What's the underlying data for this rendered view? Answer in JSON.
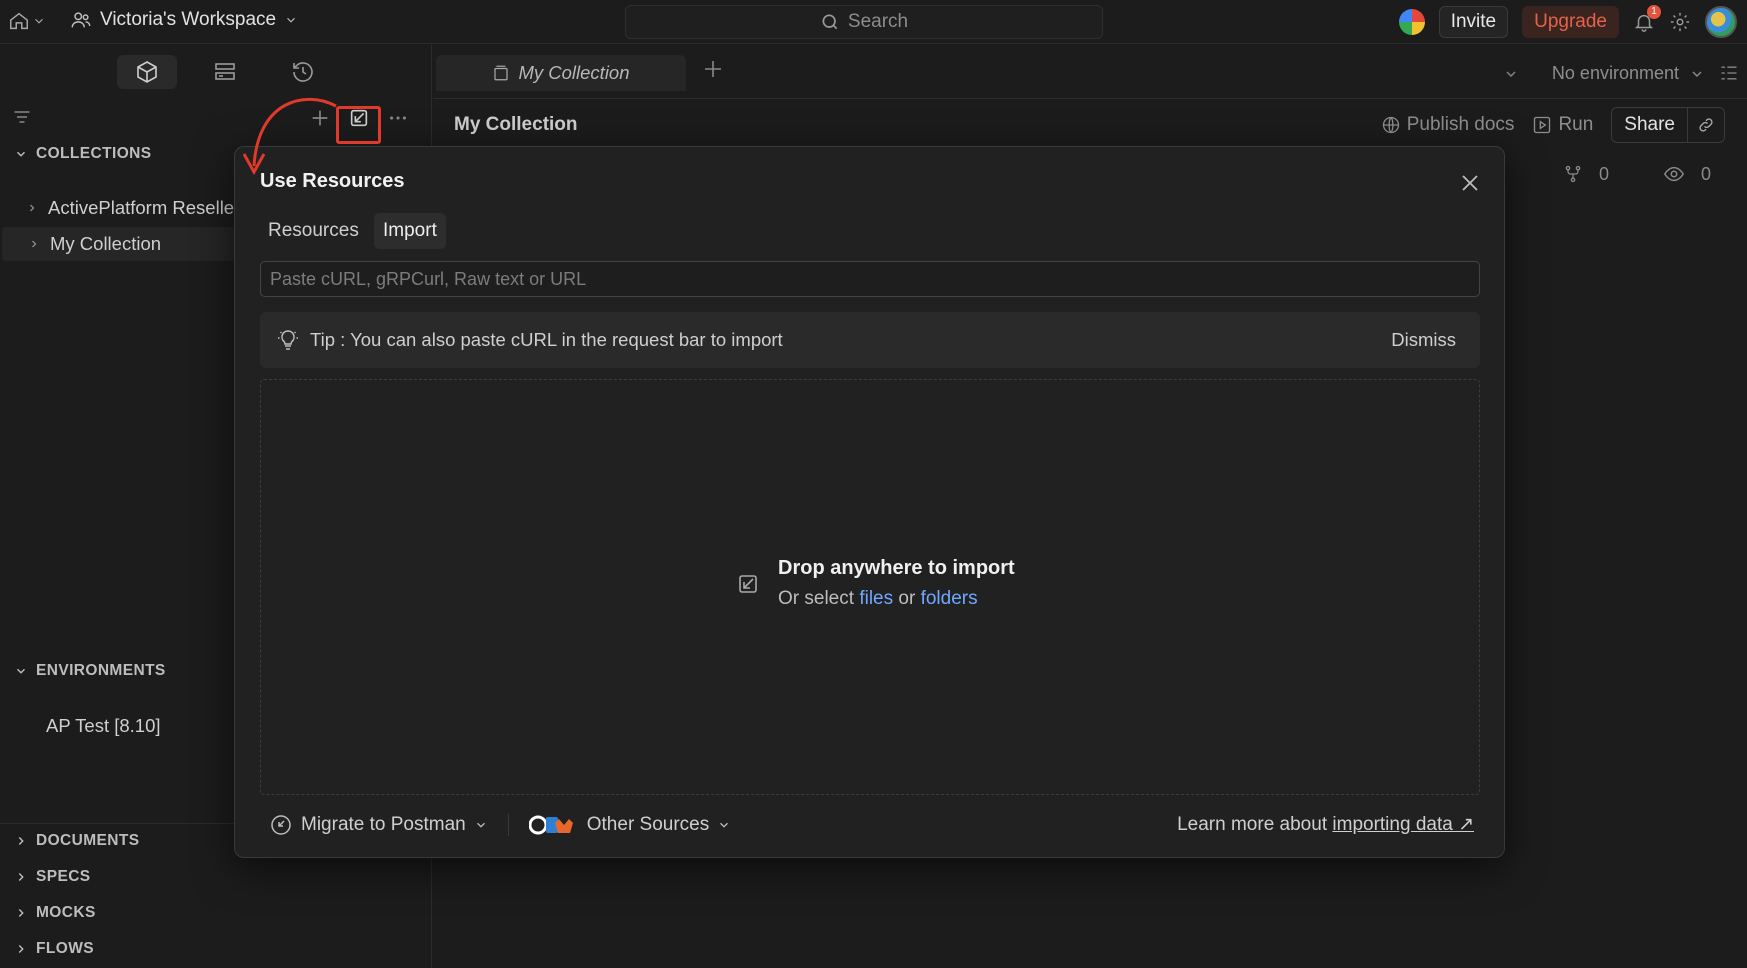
{
  "topbar": {
    "workspace": "Victoria's Workspace",
    "search_placeholder": "Search",
    "invite": "Invite",
    "upgrade": "Upgrade",
    "notifications_count": "1"
  },
  "sidebar": {
    "sections": {
      "collections": "COLLECTIONS",
      "environments": "ENVIRONMENTS",
      "documents": "DOCUMENTS",
      "specs": "SPECS",
      "mocks": "MOCKS",
      "flows": "FLOWS"
    },
    "collections": [
      "ActivePlatform Reseller",
      "My Collection"
    ],
    "environments": [
      "AP Test [8.10]"
    ]
  },
  "tabs": {
    "active": "My Collection",
    "environment": "No environment"
  },
  "collection": {
    "title": "My Collection",
    "publish_docs": "Publish docs",
    "run": "Run",
    "share": "Share",
    "forks": "0",
    "watchers": "0"
  },
  "modal": {
    "title": "Use Resources",
    "tabs": [
      "Resources",
      "Import"
    ],
    "active_tab": "Import",
    "input_placeholder": "Paste cURL, gRPCurl, Raw text or URL",
    "tip": "Tip : You can also paste cURL in the request bar to import",
    "dismiss": "Dismiss",
    "drop_title": "Drop anywhere to import",
    "drop_or_select": "Or select",
    "drop_files": "files",
    "drop_or": "or",
    "drop_folders": "folders",
    "migrate": "Migrate to Postman",
    "other_sources": "Other Sources",
    "learn_more": "Learn more about",
    "learn_link": "importing data ↗"
  },
  "colors": {
    "accent_link": "#6fa8ff",
    "upgrade": "#e5624a",
    "annotation": "#e03a2d"
  }
}
